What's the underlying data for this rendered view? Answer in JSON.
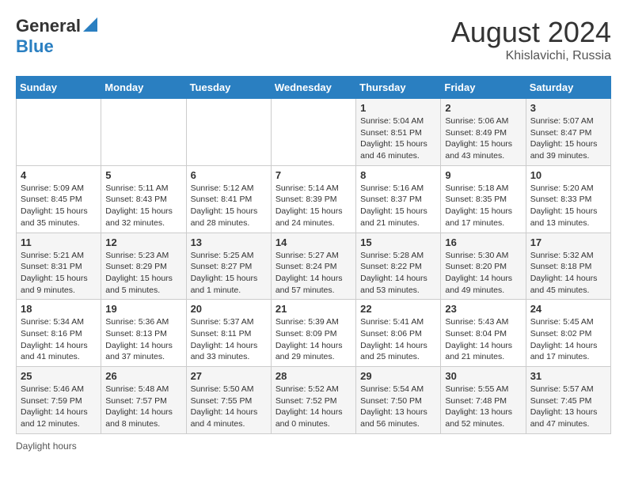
{
  "header": {
    "logo_general": "General",
    "logo_blue": "Blue",
    "month": "August 2024",
    "location": "Khislavichi, Russia"
  },
  "days_of_week": [
    "Sunday",
    "Monday",
    "Tuesday",
    "Wednesday",
    "Thursday",
    "Friday",
    "Saturday"
  ],
  "weeks": [
    [
      {
        "day": "",
        "sunrise": "",
        "sunset": "",
        "daylight": ""
      },
      {
        "day": "",
        "sunrise": "",
        "sunset": "",
        "daylight": ""
      },
      {
        "day": "",
        "sunrise": "",
        "sunset": "",
        "daylight": ""
      },
      {
        "day": "",
        "sunrise": "",
        "sunset": "",
        "daylight": ""
      },
      {
        "day": "1",
        "sunrise": "Sunrise: 5:04 AM",
        "sunset": "Sunset: 8:51 PM",
        "daylight": "Daylight: 15 hours and 46 minutes."
      },
      {
        "day": "2",
        "sunrise": "Sunrise: 5:06 AM",
        "sunset": "Sunset: 8:49 PM",
        "daylight": "Daylight: 15 hours and 43 minutes."
      },
      {
        "day": "3",
        "sunrise": "Sunrise: 5:07 AM",
        "sunset": "Sunset: 8:47 PM",
        "daylight": "Daylight: 15 hours and 39 minutes."
      }
    ],
    [
      {
        "day": "4",
        "sunrise": "Sunrise: 5:09 AM",
        "sunset": "Sunset: 8:45 PM",
        "daylight": "Daylight: 15 hours and 35 minutes."
      },
      {
        "day": "5",
        "sunrise": "Sunrise: 5:11 AM",
        "sunset": "Sunset: 8:43 PM",
        "daylight": "Daylight: 15 hours and 32 minutes."
      },
      {
        "day": "6",
        "sunrise": "Sunrise: 5:12 AM",
        "sunset": "Sunset: 8:41 PM",
        "daylight": "Daylight: 15 hours and 28 minutes."
      },
      {
        "day": "7",
        "sunrise": "Sunrise: 5:14 AM",
        "sunset": "Sunset: 8:39 PM",
        "daylight": "Daylight: 15 hours and 24 minutes."
      },
      {
        "day": "8",
        "sunrise": "Sunrise: 5:16 AM",
        "sunset": "Sunset: 8:37 PM",
        "daylight": "Daylight: 15 hours and 21 minutes."
      },
      {
        "day": "9",
        "sunrise": "Sunrise: 5:18 AM",
        "sunset": "Sunset: 8:35 PM",
        "daylight": "Daylight: 15 hours and 17 minutes."
      },
      {
        "day": "10",
        "sunrise": "Sunrise: 5:20 AM",
        "sunset": "Sunset: 8:33 PM",
        "daylight": "Daylight: 15 hours and 13 minutes."
      }
    ],
    [
      {
        "day": "11",
        "sunrise": "Sunrise: 5:21 AM",
        "sunset": "Sunset: 8:31 PM",
        "daylight": "Daylight: 15 hours and 9 minutes."
      },
      {
        "day": "12",
        "sunrise": "Sunrise: 5:23 AM",
        "sunset": "Sunset: 8:29 PM",
        "daylight": "Daylight: 15 hours and 5 minutes."
      },
      {
        "day": "13",
        "sunrise": "Sunrise: 5:25 AM",
        "sunset": "Sunset: 8:27 PM",
        "daylight": "Daylight: 15 hours and 1 minute."
      },
      {
        "day": "14",
        "sunrise": "Sunrise: 5:27 AM",
        "sunset": "Sunset: 8:24 PM",
        "daylight": "Daylight: 14 hours and 57 minutes."
      },
      {
        "day": "15",
        "sunrise": "Sunrise: 5:28 AM",
        "sunset": "Sunset: 8:22 PM",
        "daylight": "Daylight: 14 hours and 53 minutes."
      },
      {
        "day": "16",
        "sunrise": "Sunrise: 5:30 AM",
        "sunset": "Sunset: 8:20 PM",
        "daylight": "Daylight: 14 hours and 49 minutes."
      },
      {
        "day": "17",
        "sunrise": "Sunrise: 5:32 AM",
        "sunset": "Sunset: 8:18 PM",
        "daylight": "Daylight: 14 hours and 45 minutes."
      }
    ],
    [
      {
        "day": "18",
        "sunrise": "Sunrise: 5:34 AM",
        "sunset": "Sunset: 8:16 PM",
        "daylight": "Daylight: 14 hours and 41 minutes."
      },
      {
        "day": "19",
        "sunrise": "Sunrise: 5:36 AM",
        "sunset": "Sunset: 8:13 PM",
        "daylight": "Daylight: 14 hours and 37 minutes."
      },
      {
        "day": "20",
        "sunrise": "Sunrise: 5:37 AM",
        "sunset": "Sunset: 8:11 PM",
        "daylight": "Daylight: 14 hours and 33 minutes."
      },
      {
        "day": "21",
        "sunrise": "Sunrise: 5:39 AM",
        "sunset": "Sunset: 8:09 PM",
        "daylight": "Daylight: 14 hours and 29 minutes."
      },
      {
        "day": "22",
        "sunrise": "Sunrise: 5:41 AM",
        "sunset": "Sunset: 8:06 PM",
        "daylight": "Daylight: 14 hours and 25 minutes."
      },
      {
        "day": "23",
        "sunrise": "Sunrise: 5:43 AM",
        "sunset": "Sunset: 8:04 PM",
        "daylight": "Daylight: 14 hours and 21 minutes."
      },
      {
        "day": "24",
        "sunrise": "Sunrise: 5:45 AM",
        "sunset": "Sunset: 8:02 PM",
        "daylight": "Daylight: 14 hours and 17 minutes."
      }
    ],
    [
      {
        "day": "25",
        "sunrise": "Sunrise: 5:46 AM",
        "sunset": "Sunset: 7:59 PM",
        "daylight": "Daylight: 14 hours and 12 minutes."
      },
      {
        "day": "26",
        "sunrise": "Sunrise: 5:48 AM",
        "sunset": "Sunset: 7:57 PM",
        "daylight": "Daylight: 14 hours and 8 minutes."
      },
      {
        "day": "27",
        "sunrise": "Sunrise: 5:50 AM",
        "sunset": "Sunset: 7:55 PM",
        "daylight": "Daylight: 14 hours and 4 minutes."
      },
      {
        "day": "28",
        "sunrise": "Sunrise: 5:52 AM",
        "sunset": "Sunset: 7:52 PM",
        "daylight": "Daylight: 14 hours and 0 minutes."
      },
      {
        "day": "29",
        "sunrise": "Sunrise: 5:54 AM",
        "sunset": "Sunset: 7:50 PM",
        "daylight": "Daylight: 13 hours and 56 minutes."
      },
      {
        "day": "30",
        "sunrise": "Sunrise: 5:55 AM",
        "sunset": "Sunset: 7:48 PM",
        "daylight": "Daylight: 13 hours and 52 minutes."
      },
      {
        "day": "31",
        "sunrise": "Sunrise: 5:57 AM",
        "sunset": "Sunset: 7:45 PM",
        "daylight": "Daylight: 13 hours and 47 minutes."
      }
    ]
  ],
  "footer": {
    "daylight_label": "Daylight hours"
  }
}
